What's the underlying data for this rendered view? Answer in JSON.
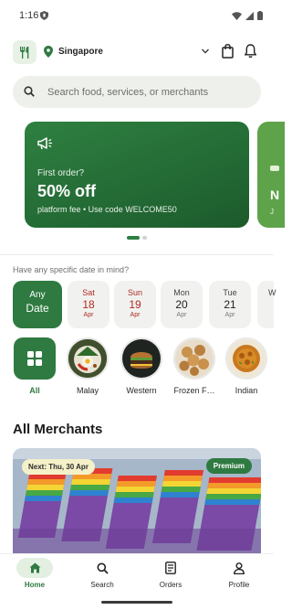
{
  "status_bar": {
    "time": "1:16"
  },
  "top_bar": {
    "location": "Singapore"
  },
  "search": {
    "placeholder": "Search food, services, or merchants"
  },
  "promo": {
    "lead": "First order?",
    "headline": "50% off",
    "subtext": "platform fee • Use code WELCOME50",
    "peek_initial": "N",
    "peek_sub": "J"
  },
  "carousel": {
    "total": 2,
    "active_index": 0
  },
  "date_picker": {
    "question": "Have any specific date in mind?",
    "any": {
      "line1": "Any",
      "line2": "Date"
    },
    "dates": [
      {
        "weekday": "Sat",
        "day": "18",
        "month": "Apr",
        "weekend": true
      },
      {
        "weekday": "Sun",
        "day": "19",
        "month": "Apr",
        "weekend": true
      },
      {
        "weekday": "Mon",
        "day": "20",
        "month": "Apr",
        "weekend": false
      },
      {
        "weekday": "Tue",
        "day": "21",
        "month": "Apr",
        "weekend": false
      },
      {
        "weekday": "W",
        "day": "",
        "month": "",
        "weekend": false
      }
    ]
  },
  "categories": [
    {
      "label": "All",
      "icon": "grid-icon"
    },
    {
      "label": "Malay",
      "icon": "malay-food-image"
    },
    {
      "label": "Western",
      "icon": "burger-image"
    },
    {
      "label": "Frozen F…",
      "icon": "frozen-food-image"
    },
    {
      "label": "Indian",
      "icon": "indian-food-image"
    }
  ],
  "merchants": {
    "title": "All Merchants",
    "card": {
      "next_label": "Next: Thu, 30 Apr",
      "badge": "Premium"
    }
  },
  "bottom_nav": [
    {
      "label": "Home",
      "icon": "home-icon",
      "active": true
    },
    {
      "label": "Search",
      "icon": "search-icon",
      "active": false
    },
    {
      "label": "Orders",
      "icon": "orders-icon",
      "active": false
    },
    {
      "label": "Profile",
      "icon": "profile-icon",
      "active": false
    }
  ],
  "colors": {
    "brand": "#2f7a41",
    "promo_bg": "#236a35",
    "weekend_text": "#b12a24",
    "search_bg": "#eef0ec"
  }
}
